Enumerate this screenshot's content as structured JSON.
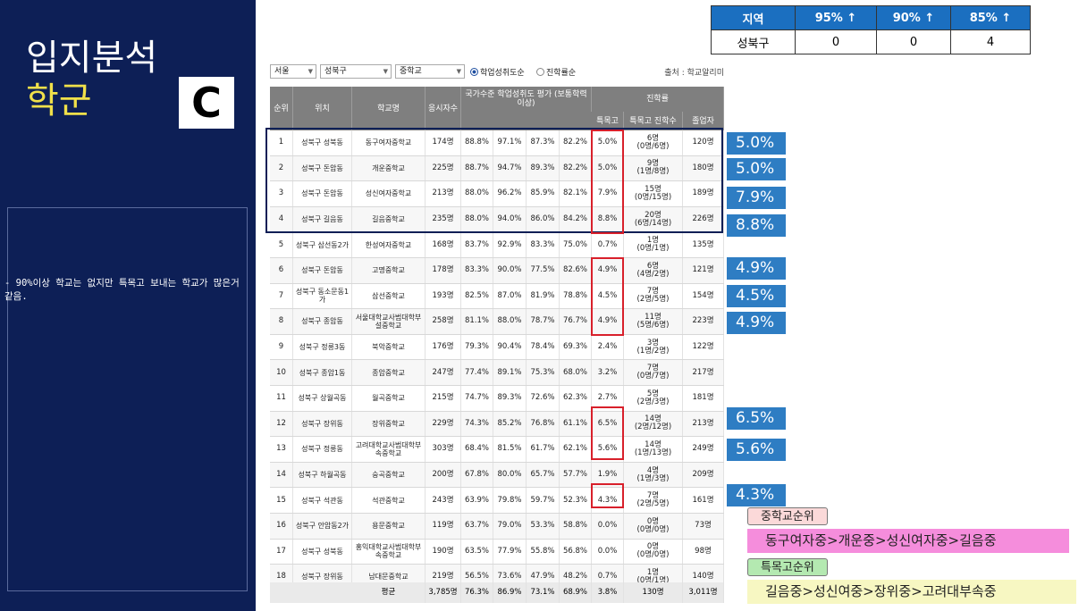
{
  "left_panel": {
    "title_line1": "입지분석",
    "title_line2": "학군",
    "badge": "C",
    "note": "- 90%이상 학교는 없지만 특목고 보내는 학교가 많은거 같음."
  },
  "summary": {
    "headers": [
      "지역",
      "95% ↑",
      "90% ↑",
      "85% ↑"
    ],
    "row": [
      "성북구",
      "0",
      "0",
      "4"
    ]
  },
  "filters": {
    "region": "서울",
    "district": "성북구",
    "level": "중학교",
    "radio1": "학업성취도순",
    "radio2": "진학률순",
    "source": "출처 : 학교알리미"
  },
  "table": {
    "headers": {
      "rank": "순위",
      "location": "위치",
      "school": "학교명",
      "applicants": "응시자수",
      "achievement_group": "국가수준 학업성취도 평가 (보통학력 이상)",
      "advance_group": "진학률",
      "special_rate": "특목고",
      "special_count": "특목고 진학수",
      "grads": "졸업자"
    },
    "rows": [
      {
        "rank": "1",
        "loc": "성북구 성북동",
        "school": "동구여자중학교",
        "n": "174명",
        "a": "88.8%",
        "b": "97.1%",
        "c": "87.3%",
        "d": "82.2%",
        "rate": "5.0%",
        "cnt": "6명",
        "sub": "(0명/6명)",
        "grad": "120명"
      },
      {
        "rank": "2",
        "loc": "성북구 돈암동",
        "school": "개운중학교",
        "n": "225명",
        "a": "88.7%",
        "b": "94.7%",
        "c": "89.3%",
        "d": "82.2%",
        "rate": "5.0%",
        "cnt": "9명",
        "sub": "(1명/8명)",
        "grad": "180명"
      },
      {
        "rank": "3",
        "loc": "성북구 돈암동",
        "school": "성신여자중학교",
        "n": "213명",
        "a": "88.0%",
        "b": "96.2%",
        "c": "85.9%",
        "d": "82.1%",
        "rate": "7.9%",
        "cnt": "15명",
        "sub": "(0명/15명)",
        "grad": "189명"
      },
      {
        "rank": "4",
        "loc": "성북구 길음동",
        "school": "길음중학교",
        "n": "235명",
        "a": "88.0%",
        "b": "94.0%",
        "c": "86.0%",
        "d": "84.2%",
        "rate": "8.8%",
        "cnt": "20명",
        "sub": "(6명/14명)",
        "grad": "226명"
      },
      {
        "rank": "5",
        "loc": "성북구 삼선동2가",
        "school": "한성여자중학교",
        "n": "168명",
        "a": "83.7%",
        "b": "92.9%",
        "c": "83.3%",
        "d": "75.0%",
        "rate": "0.7%",
        "cnt": "1명",
        "sub": "(0명/1명)",
        "grad": "135명"
      },
      {
        "rank": "6",
        "loc": "성북구 돈암동",
        "school": "고명중학교",
        "n": "178명",
        "a": "83.3%",
        "b": "90.0%",
        "c": "77.5%",
        "d": "82.6%",
        "rate": "4.9%",
        "cnt": "6명",
        "sub": "(4명/2명)",
        "grad": "121명"
      },
      {
        "rank": "7",
        "loc": "성북구 동소문동1가",
        "school": "삼선중학교",
        "n": "193명",
        "a": "82.5%",
        "b": "87.0%",
        "c": "81.9%",
        "d": "78.8%",
        "rate": "4.5%",
        "cnt": "7명",
        "sub": "(2명/5명)",
        "grad": "154명"
      },
      {
        "rank": "8",
        "loc": "성북구 종암동",
        "school": "서울대학교사범대학부설중학교",
        "n": "258명",
        "a": "81.1%",
        "b": "88.0%",
        "c": "78.7%",
        "d": "76.7%",
        "rate": "4.9%",
        "cnt": "11명",
        "sub": "(5명/6명)",
        "grad": "223명"
      },
      {
        "rank": "9",
        "loc": "성북구 정릉3동",
        "school": "북악중학교",
        "n": "176명",
        "a": "79.3%",
        "b": "90.4%",
        "c": "78.4%",
        "d": "69.3%",
        "rate": "2.4%",
        "cnt": "3명",
        "sub": "(1명/2명)",
        "grad": "122명"
      },
      {
        "rank": "10",
        "loc": "성북구 종암1동",
        "school": "종암중학교",
        "n": "247명",
        "a": "77.4%",
        "b": "89.1%",
        "c": "75.3%",
        "d": "68.0%",
        "rate": "3.2%",
        "cnt": "7명",
        "sub": "(0명/7명)",
        "grad": "217명"
      },
      {
        "rank": "11",
        "loc": "성북구 상월곡동",
        "school": "월곡중학교",
        "n": "215명",
        "a": "74.7%",
        "b": "89.3%",
        "c": "72.6%",
        "d": "62.3%",
        "rate": "2.7%",
        "cnt": "5명",
        "sub": "(2명/3명)",
        "grad": "181명"
      },
      {
        "rank": "12",
        "loc": "성북구 장위동",
        "school": "장위중학교",
        "n": "229명",
        "a": "74.3%",
        "b": "85.2%",
        "c": "76.8%",
        "d": "61.1%",
        "rate": "6.5%",
        "cnt": "14명",
        "sub": "(2명/12명)",
        "grad": "213명"
      },
      {
        "rank": "13",
        "loc": "성북구 정릉동",
        "school": "고려대학교사범대학부속중학교",
        "n": "303명",
        "a": "68.4%",
        "b": "81.5%",
        "c": "61.7%",
        "d": "62.1%",
        "rate": "5.6%",
        "cnt": "14명",
        "sub": "(1명/13명)",
        "grad": "249명"
      },
      {
        "rank": "14",
        "loc": "성북구 하월곡동",
        "school": "숭곡중학교",
        "n": "200명",
        "a": "67.8%",
        "b": "80.0%",
        "c": "65.7%",
        "d": "57.7%",
        "rate": "1.9%",
        "cnt": "4명",
        "sub": "(1명/3명)",
        "grad": "209명"
      },
      {
        "rank": "15",
        "loc": "성북구 석관동",
        "school": "석관중학교",
        "n": "243명",
        "a": "63.9%",
        "b": "79.8%",
        "c": "59.7%",
        "d": "52.3%",
        "rate": "4.3%",
        "cnt": "7명",
        "sub": "(2명/5명)",
        "grad": "161명"
      },
      {
        "rank": "16",
        "loc": "성북구 안암동2가",
        "school": "용문중학교",
        "n": "119명",
        "a": "63.7%",
        "b": "79.0%",
        "c": "53.3%",
        "d": "58.8%",
        "rate": "0.0%",
        "cnt": "0명",
        "sub": "(0명/0명)",
        "grad": "73명"
      },
      {
        "rank": "17",
        "loc": "성북구 성북동",
        "school": "홍익대학교사범대학부속중학교",
        "n": "190명",
        "a": "63.5%",
        "b": "77.9%",
        "c": "55.8%",
        "d": "56.8%",
        "rate": "0.0%",
        "cnt": "0명",
        "sub": "(0명/0명)",
        "grad": "98명"
      },
      {
        "rank": "18",
        "loc": "성북구 장위동",
        "school": "남대문중학교",
        "n": "219명",
        "a": "56.5%",
        "b": "73.6%",
        "c": "47.9%",
        "d": "48.2%",
        "rate": "0.7%",
        "cnt": "1명",
        "sub": "(0명/1명)",
        "grad": "140명"
      }
    ],
    "footer": {
      "label": "평균",
      "n": "3,785명",
      "a": "76.3%",
      "b": "86.9%",
      "c": "73.1%",
      "d": "68.9%",
      "rate": "3.8%",
      "cnt": "130명",
      "grad": "3,011명"
    }
  },
  "callouts": [
    "5.0%",
    "5.0%",
    "7.9%",
    "8.8%",
    "4.9%",
    "4.5%",
    "4.9%",
    "6.5%",
    "5.6%",
    "4.3%"
  ],
  "legend": {
    "middle_tag": "중학교순위",
    "middle_rank": "동구여자중>개운중>성신여자중>길음중",
    "special_tag": "특목고순위",
    "special_rank": "길음중>성신여중>장위중>고려대부속중"
  },
  "colors": {
    "navy": "#0d1f56",
    "accent_yellow": "#f0e04a",
    "callout_blue": "#2e7dc3",
    "red_box": "#d8202b",
    "header_blue": "#1b6fc0"
  }
}
